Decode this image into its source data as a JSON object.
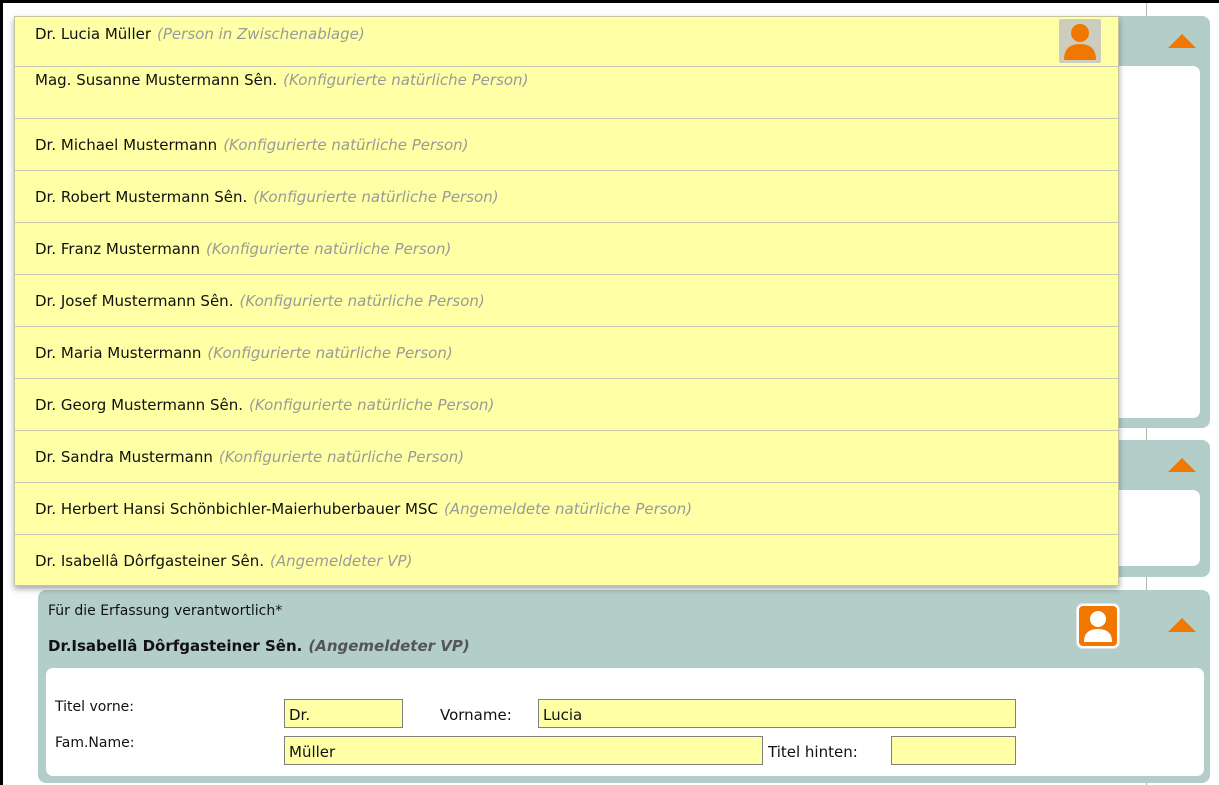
{
  "dropdown": {
    "items": [
      {
        "name": "Dr. Lucia Müller",
        "note": "(Person in Zwischenablage)"
      },
      {
        "name": "Mag. Susanne Mustermann Sên.",
        "note": "(Konfigurierte natürliche Person)"
      },
      {
        "name": "Dr. Michael Mustermann",
        "note": "(Konfigurierte natürliche Person)"
      },
      {
        "name": "Dr. Robert Mustermann Sên.",
        "note": "(Konfigurierte natürliche Person)"
      },
      {
        "name": "Dr. Franz Mustermann",
        "note": "(Konfigurierte natürliche Person)"
      },
      {
        "name": "Dr. Josef Mustermann Sên.",
        "note": "(Konfigurierte natürliche Person)"
      },
      {
        "name": "Dr. Maria Mustermann",
        "note": "(Konfigurierte natürliche Person)"
      },
      {
        "name": "Dr. Georg Mustermann Sên.",
        "note": "(Konfigurierte natürliche Person)"
      },
      {
        "name": "Dr. Sandra Mustermann",
        "note": "(Konfigurierte natürliche Person)"
      },
      {
        "name": "Dr. Herbert Hansi Schönbichler-Maierhuberbauer MSC",
        "note": "(Angemeldete natürliche Person)"
      },
      {
        "name": "Dr. Isabellâ Dôrfgasteiner Sên.",
        "note": "(Angemeldeter VP)"
      }
    ],
    "person_icon": "person-icon"
  },
  "responsible": {
    "label": "Für die Erfassung verantwortlich*",
    "name": "Dr.Isabellâ Dôrfgasteiner Sên.",
    "note": "(Angemeldeter VP)",
    "person_icon": "person-icon"
  },
  "form": {
    "titel_vorne_label": "Titel vorne:",
    "titel_vorne_value": "Dr.",
    "vorname_label": "Vorname:",
    "vorname_value": "Lucia",
    "famname_label": "Fam.Name:",
    "famname_value": "Müller",
    "titel_hinten_label": "Titel hinten:",
    "titel_hinten_value": ""
  },
  "colors": {
    "accent": "#f07800",
    "panel": "#b3cdc8",
    "dropdown_bg": "#ffffa6"
  }
}
